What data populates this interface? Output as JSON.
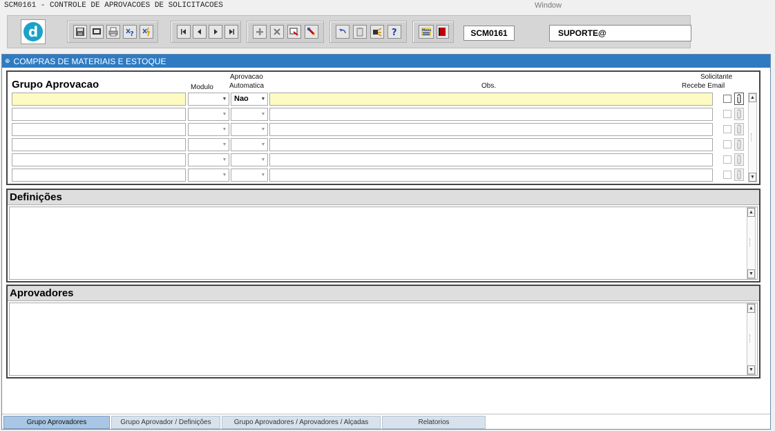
{
  "app": {
    "title": "SCM0161 - CONTROLE DE APROVACOES DE SOLICITACOES",
    "menu_window": "Window"
  },
  "toolbar": {
    "logo_letter": "d",
    "screen_code": "SCM0161",
    "user": "SUPORTE@",
    "buttons": [
      "save-icon",
      "screen-icon",
      "print-icon",
      "query-icon",
      "execute-query-icon",
      "first-record-icon",
      "previous-record-icon",
      "next-record-icon",
      "last-record-icon",
      "insert-record-icon",
      "delete-record-icon",
      "duplicate-record-icon",
      "edit-icon",
      "undo-icon",
      "clipboard-icon",
      "tools-icon",
      "help-icon",
      "menu-icon",
      "exit-icon"
    ],
    "menu_icon_text": "Menu"
  },
  "window": {
    "title": "COMPRAS DE MATERIAIS E ESTOQUE"
  },
  "grid": {
    "title": "Grupo Aprovacao",
    "col_modulo": "Modulo",
    "col_aprov_line1": "Aprovacao",
    "col_aprov_line2": "Automatica",
    "col_obs": "Obs.",
    "col_solic_line1": "Solicitante",
    "col_solic_line2": "Recebe Email",
    "rows": [
      {
        "grupo": "",
        "modulo": "",
        "aprovacao": "Nao",
        "obs": ""
      },
      {
        "grupo": "",
        "modulo": "",
        "aprovacao": "",
        "obs": ""
      },
      {
        "grupo": "",
        "modulo": "",
        "aprovacao": "",
        "obs": ""
      },
      {
        "grupo": "",
        "modulo": "",
        "aprovacao": "",
        "obs": ""
      },
      {
        "grupo": "",
        "modulo": "",
        "aprovacao": "",
        "obs": ""
      },
      {
        "grupo": "",
        "modulo": "",
        "aprovacao": "",
        "obs": ""
      }
    ]
  },
  "definicoes": {
    "title": "Definições"
  },
  "aprovadores": {
    "title": "Aprovadores"
  },
  "tabs": [
    {
      "label": "Grupo Aprovadores",
      "active": true
    },
    {
      "label": "Grupo Aprovador / Definições",
      "active": false
    },
    {
      "label": "Grupo Aprovadores / Aprovadores / Alçadas",
      "active": false
    },
    {
      "label": "Relatorios",
      "active": false
    }
  ],
  "colors": {
    "header_blue": "#2e7bc2",
    "active_field": "#fdfbc2",
    "logo": "#1aa2c8",
    "tab_active": "#a9c6e4"
  }
}
